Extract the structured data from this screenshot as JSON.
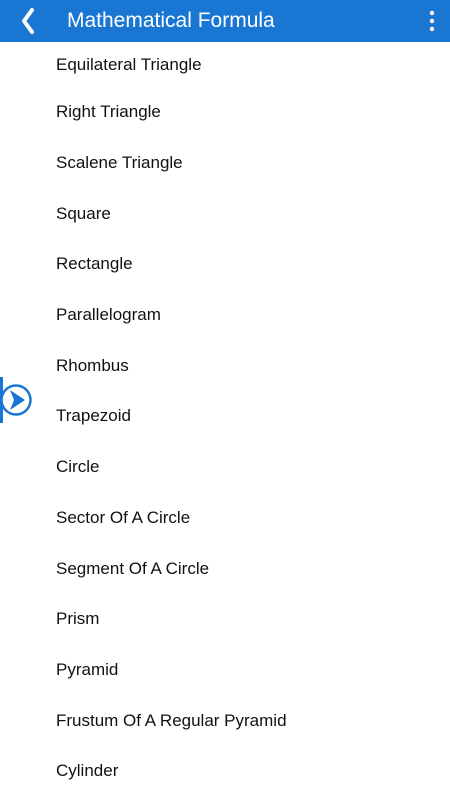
{
  "header": {
    "title": "Mathematical Formula",
    "back_icon": "chevron-left-icon",
    "menu_icon": "more-vert-icon",
    "color": "#1976d2"
  },
  "list": {
    "items": [
      {
        "label": "Equilateral Triangle"
      },
      {
        "label": "Right Triangle"
      },
      {
        "label": "Scalene Triangle"
      },
      {
        "label": "Square"
      },
      {
        "label": "Rectangle"
      },
      {
        "label": "Parallelogram"
      },
      {
        "label": "Rhombus"
      },
      {
        "label": "Trapezoid"
      },
      {
        "label": "Circle"
      },
      {
        "label": "Sector Of A Circle"
      },
      {
        "label": "Segment Of A Circle"
      },
      {
        "label": "Prism"
      },
      {
        "label": "Pyramid"
      },
      {
        "label": "Frustum Of A Regular Pyramid"
      },
      {
        "label": "Cylinder"
      }
    ]
  },
  "side_handle": {
    "icon": "play-arrow-icon",
    "color": "#1976d2"
  }
}
